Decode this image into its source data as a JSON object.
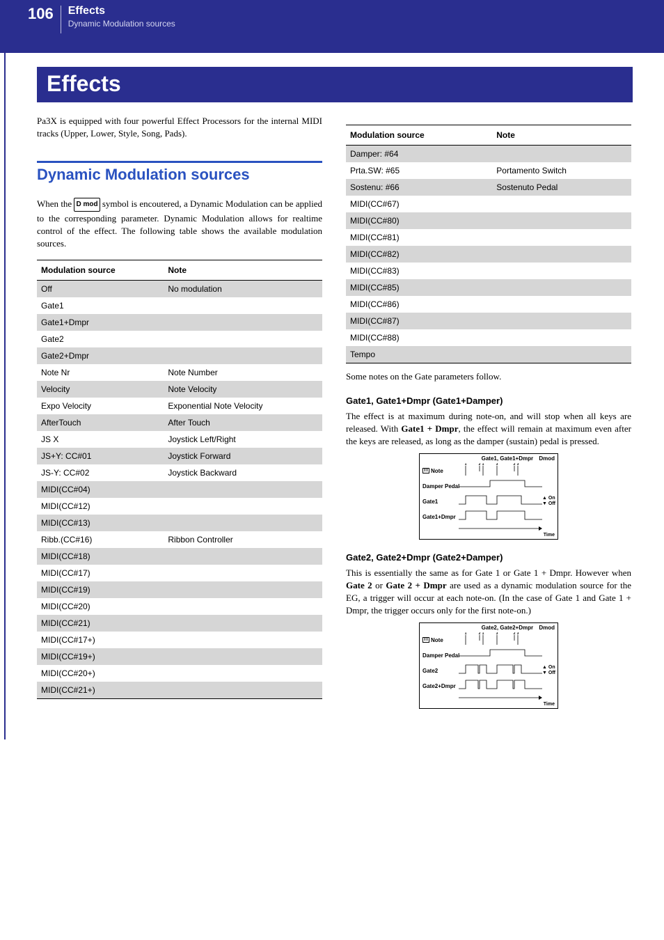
{
  "header": {
    "page_number": "106",
    "title": "Effects",
    "subtitle": "Dynamic Modulation sources"
  },
  "title_bar": "Effects",
  "intro_text": "Pa3X is equipped with four powerful Effect Processors for the internal MIDI tracks (Upper, Lower, Style, Song, Pads).",
  "section_heading": "Dynamic Modulation sources",
  "section_body_a": "When the ",
  "dmod_label": "D mod",
  "section_body_b": " symbol is encoutered, a Dynamic Modulation can be applied to the corresponding parameter. Dynamic Modulation allows for realtime control of the effect. The following table shows the available modulation sources.",
  "table_left": {
    "head": [
      "Modulation source",
      "Note"
    ],
    "rows": [
      {
        "src": "Off",
        "note": "No modulation"
      },
      {
        "src": "Gate1",
        "note": ""
      },
      {
        "src": "Gate1+Dmpr",
        "note": ""
      },
      {
        "src": "Gate2",
        "note": ""
      },
      {
        "src": "Gate2+Dmpr",
        "note": ""
      },
      {
        "src": "Note Nr",
        "note": "Note Number"
      },
      {
        "src": "Velocity",
        "note": "Note Velocity"
      },
      {
        "src": "Expo Velocity",
        "note": "Exponential Note Velocity"
      },
      {
        "src": "AfterTouch",
        "note": "After Touch"
      },
      {
        "src": "JS X",
        "note": "Joystick Left/Right"
      },
      {
        "src": "JS+Y: CC#01",
        "note": "Joystick Forward"
      },
      {
        "src": "JS-Y: CC#02",
        "note": "Joystick Backward"
      },
      {
        "src": "MIDI(CC#04)",
        "note": ""
      },
      {
        "src": "MIDI(CC#12)",
        "note": ""
      },
      {
        "src": "MIDI(CC#13)",
        "note": ""
      },
      {
        "src": "Ribb.(CC#16)",
        "note": "Ribbon Controller"
      },
      {
        "src": "MIDI(CC#18)",
        "note": ""
      },
      {
        "src": "MIDI(CC#17)",
        "note": ""
      },
      {
        "src": "MIDI(CC#19)",
        "note": ""
      },
      {
        "src": "MIDI(CC#20)",
        "note": ""
      },
      {
        "src": "MIDI(CC#21)",
        "note": ""
      },
      {
        "src": "MIDI(CC#17+)",
        "note": ""
      },
      {
        "src": "MIDI(CC#19+)",
        "note": ""
      },
      {
        "src": "MIDI(CC#20+)",
        "note": ""
      },
      {
        "src": "MIDI(CC#21+)",
        "note": ""
      }
    ]
  },
  "table_right": {
    "head": [
      "Modulation source",
      "Note"
    ],
    "rows": [
      {
        "src": "Damper: #64",
        "note": ""
      },
      {
        "src": "Prta.SW: #65",
        "note": "Portamento Switch"
      },
      {
        "src": "Sostenu: #66",
        "note": "Sostenuto Pedal"
      },
      {
        "src": "MIDI(CC#67)",
        "note": ""
      },
      {
        "src": "MIDI(CC#80)",
        "note": ""
      },
      {
        "src": "MIDI(CC#81)",
        "note": ""
      },
      {
        "src": "MIDI(CC#82)",
        "note": ""
      },
      {
        "src": "MIDI(CC#83)",
        "note": ""
      },
      {
        "src": "MIDI(CC#85)",
        "note": ""
      },
      {
        "src": "MIDI(CC#86)",
        "note": ""
      },
      {
        "src": "MIDI(CC#87)",
        "note": ""
      },
      {
        "src": "MIDI(CC#88)",
        "note": ""
      },
      {
        "src": "Tempo",
        "note": ""
      }
    ]
  },
  "right_intro": "Some notes on the Gate parameters follow.",
  "gate1": {
    "heading": "Gate1, Gate1+Dmpr (Gate1+Damper)",
    "body_a": "The effect is at maximum during note-on, and will stop when all keys are released. With ",
    "bold": "Gate1 + Dmpr",
    "body_b": ", the effect will remain at maximum even after the keys are released, as long as the damper (sustain) pedal is pressed.",
    "diagram_title": "Gate1, Gate1+Dmpr",
    "row_note": "Note",
    "row_damper": "Damper Pedal",
    "row_g1": "Gate1",
    "row_g1d": "Gate1+Dmpr",
    "on": "On",
    "off": "Off",
    "time": "Time",
    "notes_seq": [
      "1",
      "2",
      "1",
      "3",
      "2",
      "3"
    ],
    "dmod": "Dmod"
  },
  "gate2": {
    "heading": "Gate2, Gate2+Dmpr (Gate2+Damper)",
    "body_a": "This is essentially the same as for Gate 1 or Gate 1 + Dmpr. However when ",
    "bold1": "Gate 2",
    "mid": " or ",
    "bold2": "Gate 2 + Dmpr",
    "body_b": " are used as a dynamic modulation source for the EG, a trigger will occur at each note-on. (In the case of Gate 1 and Gate 1 + Dmpr, the trigger occurs only for the first note-on.)",
    "diagram_title": "Gate2, Gate2+Dmpr",
    "row_note": "Note",
    "row_damper": "Damper Pedal",
    "row_g2": "Gate2",
    "row_g2d": "Gate2+Dmpr",
    "on": "On",
    "off": "Off",
    "time": "Time",
    "notes_seq": [
      "1",
      "2",
      "1",
      "3",
      "2",
      "3"
    ],
    "dmod": "Dmod"
  }
}
